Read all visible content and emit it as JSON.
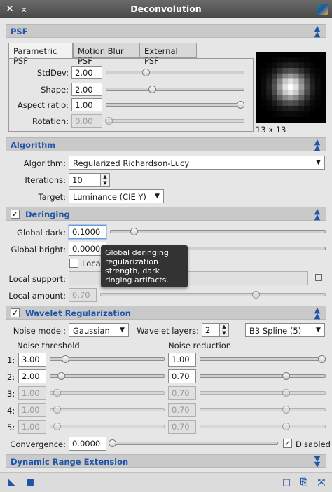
{
  "window": {
    "title": "Deconvolution"
  },
  "psf": {
    "header": "PSF",
    "tabs": [
      "Parametric PSF",
      "Motion Blur PSF",
      "External PSF"
    ],
    "stddev_label": "StdDev:",
    "stddev": "2.00",
    "stddev_level": 0.28,
    "shape_label": "Shape:",
    "shape": "2.00",
    "shape_level": 0.33,
    "aspect_label": "Aspect ratio:",
    "aspect": "1.00",
    "aspect_level": 1.0,
    "rotation_label": "Rotation:",
    "rotation": "0.00",
    "rotation_level": 0.0,
    "preview_size": "13 x 13"
  },
  "algorithm": {
    "header": "Algorithm",
    "algorithm_label": "Algorithm:",
    "algorithm": "Regularized Richardson-Lucy",
    "iterations_label": "Iterations:",
    "iterations": "10",
    "target_label": "Target:",
    "target": "Luminance (CIE Y)"
  },
  "deringing": {
    "header": "Deringing",
    "global_dark_label": "Global dark:",
    "global_dark": "0.1000",
    "global_dark_level": 0.1,
    "global_bright_label": "Global bright:",
    "global_bright": "0.0000",
    "local_label": "Local",
    "local_support_label": "Local support:",
    "local_amount_label": "Local amount:",
    "local_amount": "0.70",
    "local_amount_level": 0.7,
    "tooltip": "Global deringing regularization strength, dark ringing artifacts."
  },
  "wavelet": {
    "header": "Wavelet Regularization",
    "noise_model_label": "Noise model:",
    "noise_model": "Gaussian",
    "layers_label": "Wavelet layers:",
    "layers": "2",
    "scaling": "B3 Spline (5)",
    "threshold_header": "Noise threshold",
    "reduction_header": "Noise reduction",
    "rows": [
      {
        "label": "1:",
        "threshold": "3.00",
        "t_level": 0.12,
        "reduction": "1.00",
        "r_level": 1.0,
        "enabled": true
      },
      {
        "label": "2:",
        "threshold": "2.00",
        "t_level": 0.08,
        "reduction": "0.70",
        "r_level": 0.7,
        "enabled": true
      },
      {
        "label": "3:",
        "threshold": "1.00",
        "t_level": 0.04,
        "reduction": "0.70",
        "r_level": 0.7,
        "enabled": false
      },
      {
        "label": "4:",
        "threshold": "1.00",
        "t_level": 0.04,
        "reduction": "0.70",
        "r_level": 0.7,
        "enabled": false
      },
      {
        "label": "5:",
        "threshold": "1.00",
        "t_level": 0.04,
        "reduction": "0.70",
        "r_level": 0.7,
        "enabled": false
      }
    ],
    "convergence_label": "Convergence:",
    "convergence": "0.0000",
    "disabled_label": "Disabled"
  },
  "dre": {
    "header": "Dynamic Range Extension"
  }
}
